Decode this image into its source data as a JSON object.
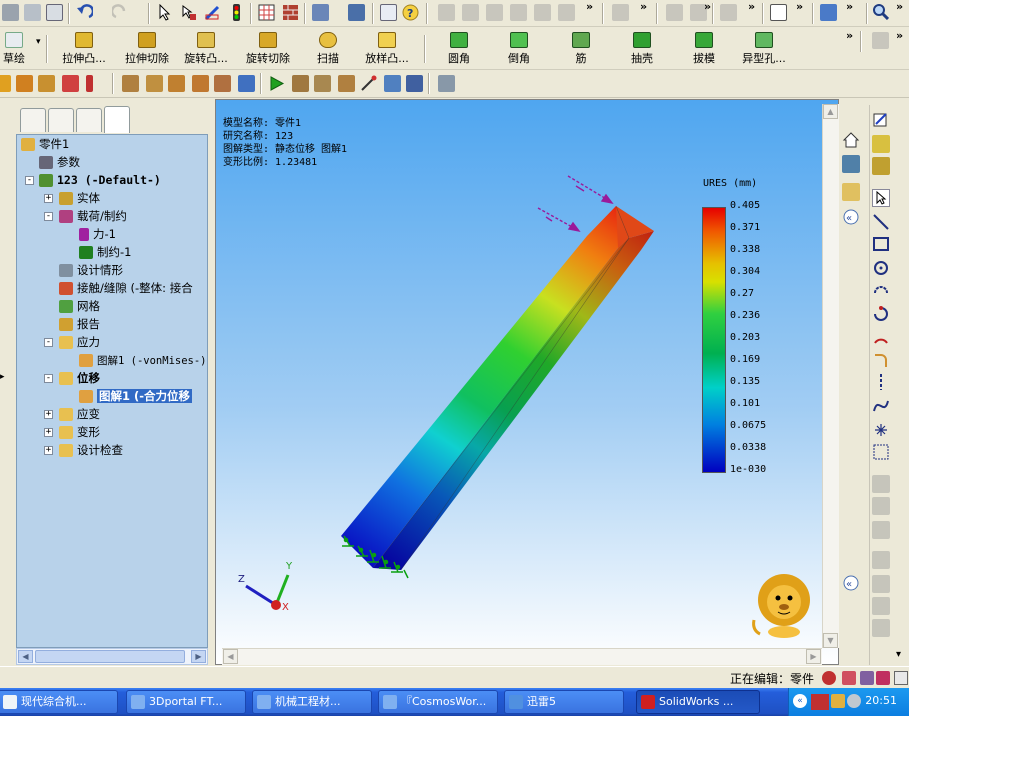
{
  "toolbar": {
    "features": {
      "sketch": "草绘",
      "extrude_boss": "拉伸凸...",
      "extrude_cut": "拉伸切除",
      "revolve_boss": "旋转凸...",
      "revolve_cut": "旋转切除",
      "sweep": "扫描",
      "loft_boss": "放样凸...",
      "fillet": "圆角",
      "chamfer": "倒角",
      "rib": "筋",
      "shell": "抽壳",
      "draft": "拔模",
      "hole_wizard": "异型孔..."
    },
    "overflow": "»"
  },
  "tree": {
    "part": "零件1",
    "params": "参数",
    "study": "123 (-Default-)",
    "solid": "实体",
    "loads": "载荷/制约",
    "force": "力-1",
    "fixture": "制约-1",
    "design_scenario": "设计情形",
    "contact": "接触/缝隙 (-整体: 接合",
    "mesh": "网格",
    "report": "报告",
    "stress": "应力",
    "stress_plot": "图解1 (-vonMises-)",
    "displacement": "位移",
    "displacement_plot": "图解1 (-合力位移",
    "strain": "应变",
    "deformation": "变形",
    "design_check": "设计检查"
  },
  "viewport": {
    "info": {
      "model_name": "模型名称: 零件1",
      "study_name": "研究名称: 123",
      "plot_type": "图解类型: 静态位移 图解1",
      "deform_scale": "变形比例: 1.23481"
    },
    "legend": {
      "title": "URES (mm)",
      "values": [
        "0.405",
        "0.371",
        "0.338",
        "0.304",
        "0.27",
        "0.236",
        "0.203",
        "0.169",
        "0.135",
        "0.101",
        "0.0675",
        "0.0338",
        "1e-030"
      ]
    },
    "triad": {
      "x": "X",
      "y": "Y",
      "z": "Z"
    }
  },
  "status": {
    "editing": "正在编辑：零件"
  },
  "taskbar": {
    "items": [
      "现代综合机...",
      "3Dportal FT...",
      "机械工程材...",
      "『CosmosWor...",
      "迅雷5",
      "SolidWorks ..."
    ],
    "clock": "20:51"
  },
  "colors": {
    "accent": "#316ac5",
    "tree_bg": "#b8d2ea",
    "taskbar": "#245edb"
  }
}
